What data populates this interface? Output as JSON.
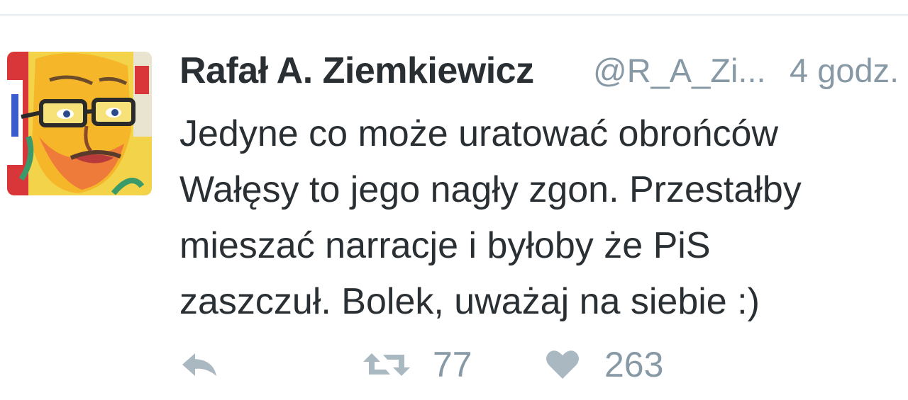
{
  "tweet": {
    "author": {
      "display_name": "Rafał A. Ziemkiewicz",
      "handle": "@R_A_Zi...",
      "avatar_icon": "profile-avatar"
    },
    "timestamp": "4 godz.",
    "text_lines": [
      "Jedyne co może uratować obrońców",
      "Wałęsy to jego nagły zgon. Przestałby",
      "mieszać narracje i byłoby że PiS",
      "zaszczuł. Bolek, uważaj na siebie :)"
    ],
    "actions": {
      "reply": {
        "icon": "reply-icon"
      },
      "retweet": {
        "icon": "retweet-icon",
        "count": "77"
      },
      "like": {
        "icon": "heart-icon",
        "count": "263"
      }
    }
  },
  "colors": {
    "text_primary": "#292f33",
    "text_secondary": "#8899a6",
    "icon_gray": "#aab8c2",
    "divider": "#e6ecf0"
  }
}
